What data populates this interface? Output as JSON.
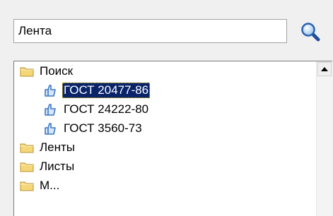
{
  "search": {
    "value": "Лента",
    "icon": "magnifier-icon"
  },
  "tree": {
    "nodes": [
      {
        "label": "Поиск",
        "icon": "folder-icon",
        "level": 0
      },
      {
        "label": "ГОСТ 20477-86",
        "icon": "document-hand-icon",
        "level": 1,
        "selected": true
      },
      {
        "label": "ГОСТ 24222-80",
        "icon": "document-hand-icon",
        "level": 1
      },
      {
        "label": "ГОСТ 3560-73",
        "icon": "document-hand-icon",
        "level": 1
      },
      {
        "label": "Ленты",
        "icon": "folder-icon",
        "level": 0
      },
      {
        "label": "Листы",
        "icon": "folder-icon",
        "level": 0
      },
      {
        "label": "М...",
        "icon": "folder-icon",
        "level": 0
      }
    ]
  },
  "colors": {
    "selection": "#0a246a",
    "folder": "#f5d779",
    "document": "#3a78c8"
  }
}
